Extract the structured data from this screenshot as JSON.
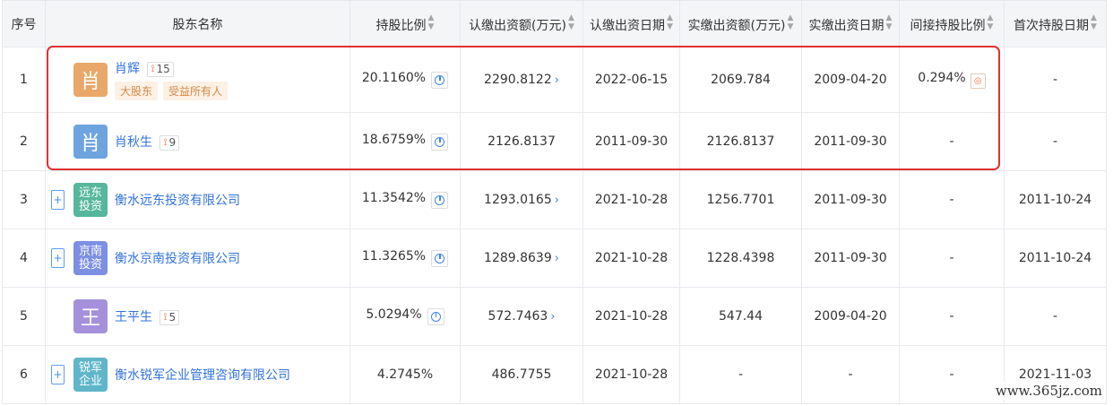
{
  "headers": [
    "序号",
    "股东名称",
    "持股比例",
    "认缴出资额(万元)",
    "认缴出资日期",
    "实缴出资额(万元)",
    "实缴出资日期",
    "间接持股比例",
    "首次持股日期"
  ],
  "sort_icon": "sort-arrows-icon",
  "rows": [
    {
      "no": "1",
      "avatar": "肖",
      "avatar_color": "#e9a869",
      "name": "肖辉",
      "rel_count": "15",
      "tags": [
        "大股东",
        "受益所有人"
      ],
      "ratio": "20.1160%",
      "subscribed": "2290.8122",
      "sub_date": "2022-06-15",
      "paid": "2069.784",
      "paid_date": "2009-04-20",
      "indirect": "0.294%",
      "first_date": "-"
    },
    {
      "no": "2",
      "avatar": "肖",
      "avatar_color": "#6ea4de",
      "name": "肖秋生",
      "rel_count": "9",
      "ratio": "18.6759%",
      "subscribed": "2126.8137",
      "sub_date": "2011-09-30",
      "paid": "2126.8137",
      "paid_date": "2011-09-30",
      "indirect": "-",
      "first_date": "-"
    },
    {
      "no": "3",
      "avatar": "远东投资",
      "avatar_color": "#56b79c",
      "name": "衡水远东投资有限公司",
      "ratio": "11.3542%",
      "subscribed": "1293.0165",
      "sub_date": "2021-10-28",
      "paid": "1256.7701",
      "paid_date": "2011-09-30",
      "indirect": "-",
      "first_date": "2011-10-24"
    },
    {
      "no": "4",
      "avatar": "京南投资",
      "avatar_color": "#7d8fe3",
      "name": "衡水京南投资有限公司",
      "ratio": "11.3265%",
      "subscribed": "1289.8639",
      "sub_date": "2021-10-28",
      "paid": "1228.4398",
      "paid_date": "2011-09-30",
      "indirect": "-",
      "first_date": "2011-10-24"
    },
    {
      "no": "5",
      "avatar": "王",
      "avatar_color": "#a590dc",
      "name": "王平生",
      "rel_count": "5",
      "ratio": "5.0294%",
      "subscribed": "572.7463",
      "sub_date": "2021-10-28",
      "paid": "547.44",
      "paid_date": "2009-04-20",
      "indirect": "-",
      "first_date": "-"
    },
    {
      "no": "6",
      "avatar": "锐军企业",
      "avatar_color": "#5fb6c9",
      "name": "衡水锐军企业管理咨询有限公司",
      "ratio": "4.2745%",
      "subscribed": "486.7755",
      "sub_date": "2021-10-28",
      "paid": "-",
      "paid_date": "-",
      "indirect": "-",
      "first_date": "2021-11-03"
    }
  ],
  "watermark": "www.365jz.com"
}
